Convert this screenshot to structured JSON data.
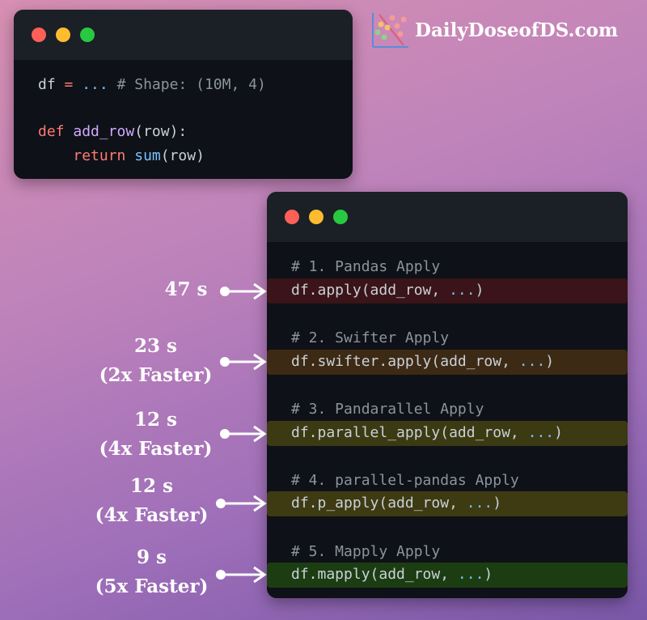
{
  "brand": {
    "name": "DailyDoseofDS.com"
  },
  "window1": {
    "line1": {
      "a": "df",
      "op": "=",
      "dots": "...",
      "comment": "# Shape: (10M, 4)"
    },
    "line2": {
      "kw": "def",
      "fn": "add_row",
      "rest": "(row):"
    },
    "line3": {
      "kw": "return",
      "bi": "sum",
      "rest": "(row)"
    }
  },
  "approaches": [
    {
      "comment": "# 1. Pandas Apply",
      "code_prefix": "df.apply(add_row, ",
      "code_suffix": ")",
      "time": "47 s",
      "speedup": ""
    },
    {
      "comment": "# 2. Swifter Apply",
      "code_prefix": "df.swifter.apply(add_row, ",
      "code_suffix": ")",
      "time": "23 s",
      "speedup": "(2x Faster)"
    },
    {
      "comment": "# 3. Pandarallel Apply",
      "code_prefix": "df.parallel_apply(add_row, ",
      "code_suffix": ")",
      "time": "12 s",
      "speedup": "(4x Faster)"
    },
    {
      "comment": "# 4. parallel-pandas Apply",
      "code_prefix": "df.p_apply(add_row, ",
      "code_suffix": ")",
      "time": "12 s",
      "speedup": "(4x Faster)"
    },
    {
      "comment": "# 5. Mapply Apply",
      "code_prefix": "df.mapply(add_row, ",
      "code_suffix": ")",
      "time": "9 s",
      "speedup": "(5x Faster)"
    }
  ],
  "ellipsis": "...",
  "colors": {
    "keyword": "#ff7b72",
    "function": "#d2a8ff",
    "builtin": "#79c0ff",
    "comment": "#8b949e"
  }
}
